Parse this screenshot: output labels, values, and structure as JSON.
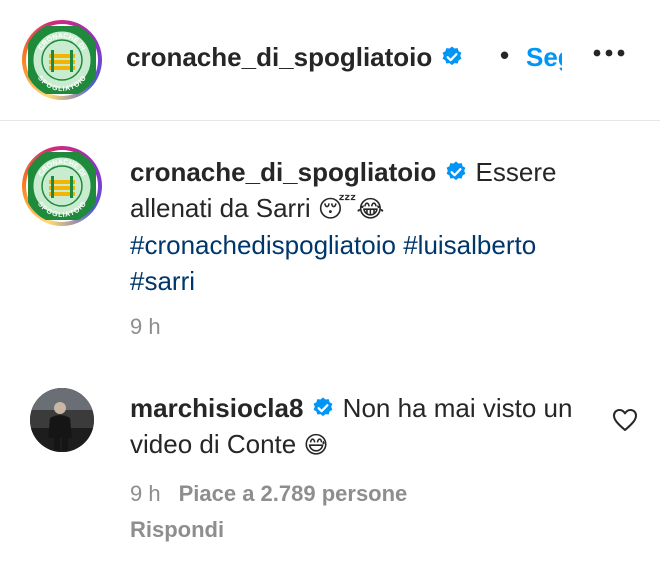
{
  "header": {
    "username": "cronache_di_spogliatoio",
    "separator": "•",
    "follow_label": "Segui",
    "more_icon": "more-horizontal-icon",
    "logo": {
      "top_text": "CRONACHE DI",
      "bottom_text": "SPOGLIATOIO",
      "colors": {
        "green": "#1f8a3b",
        "mint": "#c9ecd0",
        "gold": "#f5b400"
      }
    }
  },
  "caption": {
    "username": "cronache_di_spogliatoio",
    "text": "Essere allenati da Sarri",
    "emojis": "😴😂",
    "hashtags": [
      "#cronachedispogliatoio",
      "#luisalberto",
      "#sarri"
    ],
    "time": "9 h"
  },
  "comment": {
    "username": "marchisiocla8",
    "text": "Non ha mai visto un video di Conte",
    "emoji": "😅",
    "time": "9 h",
    "likes": "Piace a 2.789 persone",
    "reply_label": "Rispondi",
    "like_icon": "heart-outline-icon"
  },
  "colors": {
    "verified": "#0095f6",
    "link": "#0095f6",
    "hashtag": "#00376b",
    "meta": "#8e8e8e",
    "text": "#262626"
  }
}
